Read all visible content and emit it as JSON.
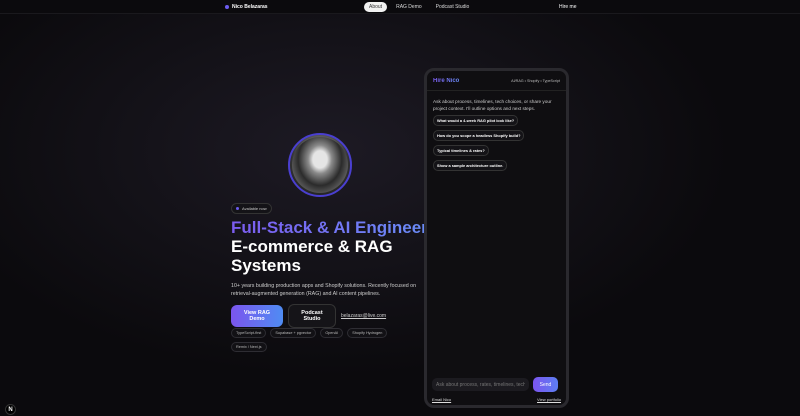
{
  "nav": {
    "brand": "Nico Belazaras",
    "tabs": [
      "About",
      "RAG Demo",
      "Podcast Studio"
    ],
    "hire": "Hire me"
  },
  "hero": {
    "badge": "Available now",
    "title_accent": "Full-Stack & AI Engineer",
    "title_rest": "E-commerce & RAG Systems",
    "description": "10+ years building production apps and Shopify solutions. Recently focused on retrieval-augmented generation (RAG) and AI content pipelines.",
    "primary_cta": "View RAG Demo",
    "secondary_cta": "Podcast Studio",
    "email": "belazaras@live.com",
    "chips": [
      "TypeScript-first",
      "Supabase + pgvector",
      "OpenAI",
      "Shopify Hydrogen",
      "Remix / Next.js"
    ]
  },
  "chat": {
    "title": "Hire Nico",
    "subtitle": "AI/RAG • Shopify • TypeScript",
    "intro": "Ask about process, timelines, tech choices, or share your project context. I'll outline options and next steps.",
    "suggestions": [
      "What would a 4-week RAG pilot look like?",
      "How do you scope a headless Shopify build?",
      "Typical timelines & rates?",
      "Show a sample architecture outline."
    ],
    "placeholder": "Ask about process, rates, timelines, tech...",
    "send": "Send",
    "email_link": "Email Nico",
    "portfolio_link": "View portfolio"
  },
  "dev_badge": "N"
}
